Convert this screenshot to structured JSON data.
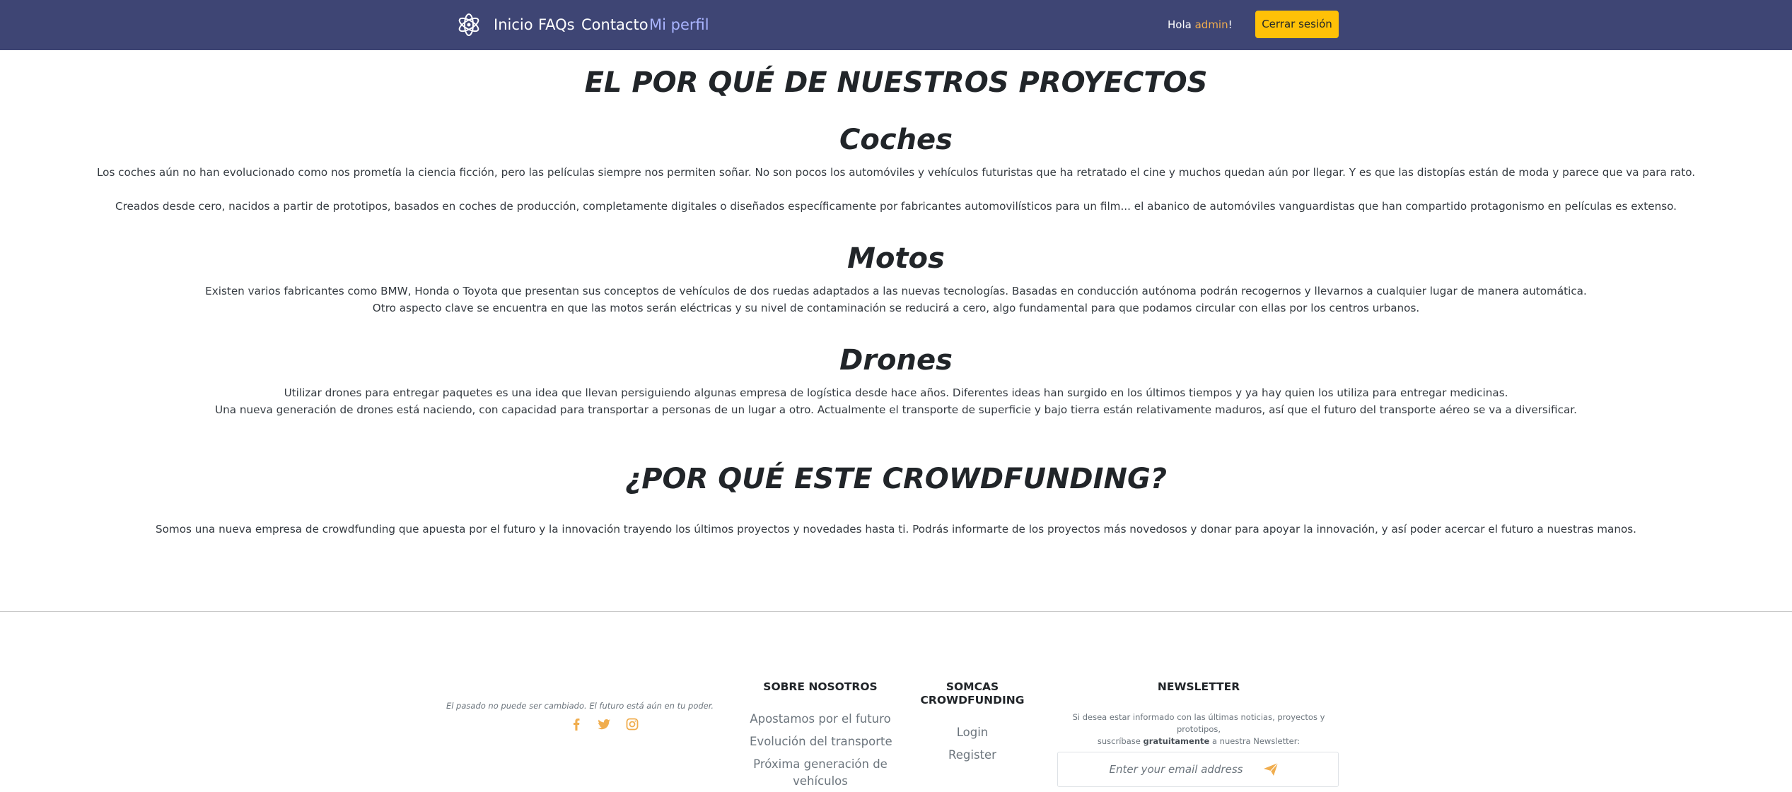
{
  "navbar": {
    "links": [
      "Inicio",
      "FAQs",
      "Contacto",
      "Mi perfil"
    ],
    "greeting_prefix": "Hola",
    "username": "admin",
    "greeting_suffix": "!",
    "logout_label": "Cerrar sesión"
  },
  "main": {
    "title": "EL POR QUÉ DE NUESTROS PROYECTOS",
    "sections": [
      {
        "heading": "Coches",
        "paragraphs": [
          "Los coches aún no han evolucionado como nos prometía la ciencia ficción, pero las películas siempre nos permiten soñar. No son pocos los automóviles y vehículos futuristas que ha retratado el cine y muchos quedan aún por llegar. Y es que las distopías están de moda y parece que va para rato.",
          "Creados desde cero, nacidos a partir de prototipos, basados en coches de producción, completamente digitales o diseñados específicamente por fabricantes automovilísticos para un film... el abanico de automóviles vanguardistas que han compartido protagonismo en películas es extenso."
        ]
      },
      {
        "heading": "Motos",
        "paragraphs": [
          "Existen varios fabricantes como BMW, Honda o Toyota que presentan sus conceptos de vehículos de dos ruedas adaptados a las nuevas tecnologías. Basadas en conducción autónoma podrán recogernos y llevarnos a cualquier lugar de manera automática.",
          "Otro aspecto clave se encuentra en que las motos serán eléctricas y su nivel de contaminación se reducirá a cero, algo fundamental para que podamos circular con ellas por los centros urbanos."
        ]
      },
      {
        "heading": "Drones",
        "paragraphs": [
          "Utilizar drones para entregar paquetes es una idea que llevan persiguiendo algunas empresa de logística desde hace años. Diferentes ideas han surgido en los últimos tiempos y ya hay quien los utiliza para entregar medicinas.",
          "Una nueva generación de drones está naciendo, con capacidad para transportar a personas de un lugar a otro. Actualmente el transporte de superficie y bajo tierra están relativamente maduros, así que el futuro del transporte aéreo se va a diversificar."
        ]
      }
    ],
    "crowdfunding_title": "¿POR QUÉ ESTE CROWDFUNDING?",
    "crowdfunding_text": "Somos una nueva empresa de crowdfunding que apuesta por el futuro y la innovación trayendo los últimos proyectos y novedades hasta ti. Podrás informarte de los proyectos más novedosos y donar para apoyar la innovación, y así poder acercar el futuro a nuestras manos."
  },
  "footer": {
    "tagline": "El pasado no puede ser cambiado. El futuro está aún en tu poder.",
    "social_icons": [
      "facebook-icon",
      "twitter-icon",
      "instagram-icon"
    ],
    "about": {
      "heading": "SOBRE NOSOTROS",
      "links": [
        "Apostamos por el futuro",
        "Evolución del transporte",
        "Próxima generación de",
        "vehículos"
      ]
    },
    "brand": {
      "heading_line1": "SOMCAS",
      "heading_line2": "CROWDFUNDING",
      "links": [
        "Login",
        "Register"
      ]
    },
    "newsletter": {
      "heading": "NEWSLETTER",
      "text_line1": "Si desea estar informado con las últimas noticias, proyectos y prototipos,",
      "text_line2_prefix": "suscríbase",
      "text_line2_bold": "gratuitamente",
      "text_line2_suffix": "a nuestra Newsletter:",
      "placeholder": "Enter your email address"
    }
  },
  "colors": {
    "navbar_bg": "#3e4574",
    "active_link": "#a9b4ff",
    "accent_orange": "#f0ad4e",
    "logout_bg": "#ffc107"
  }
}
